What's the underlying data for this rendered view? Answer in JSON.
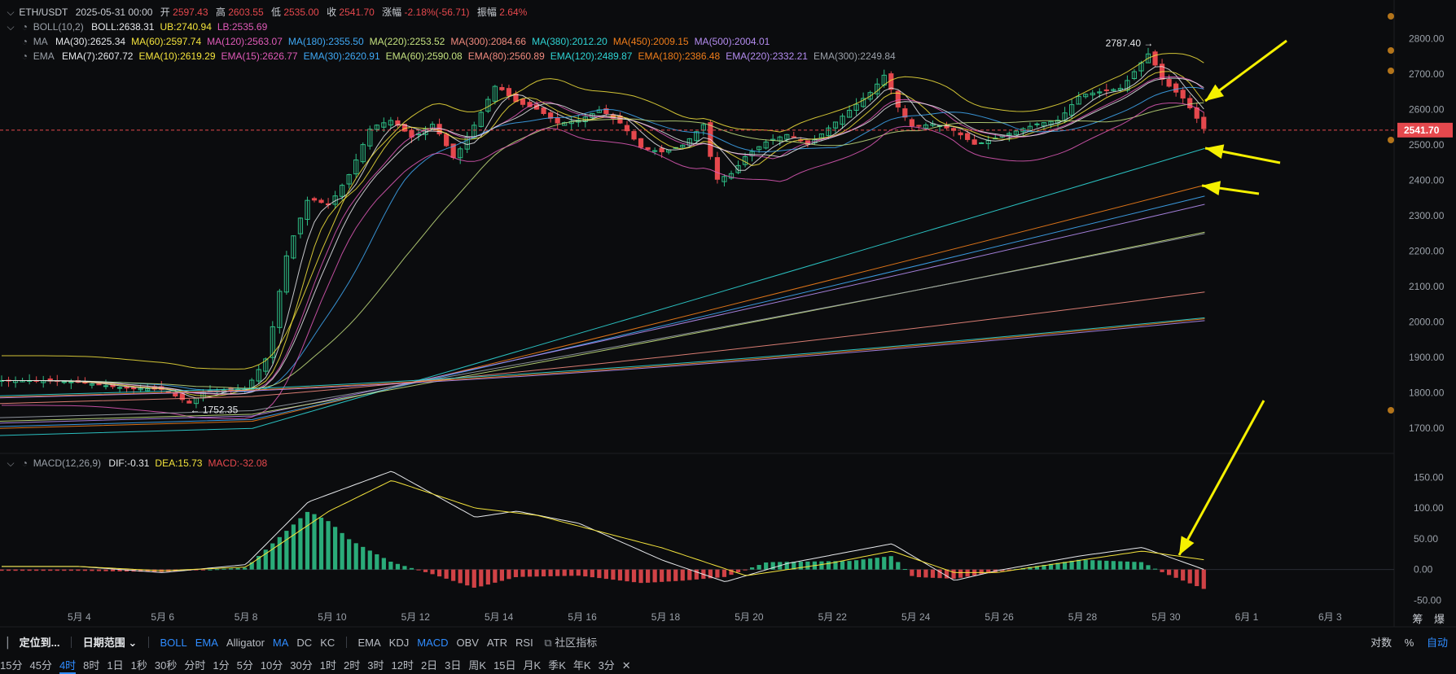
{
  "header": {
    "pair": "ETH/USDT",
    "datetime": "2025-05-31 00:00",
    "open_label": "开",
    "open": "2597.43",
    "high_label": "高",
    "high": "2603.55",
    "low_label": "低",
    "low": "2535.00",
    "close_label": "收",
    "close": "2541.70",
    "change_label": "涨幅",
    "change": "-2.18%(-56.71)",
    "amp_label": "振幅",
    "amp": "2.64%"
  },
  "boll": {
    "name": "BOLL(10,2)",
    "items": [
      {
        "text": "BOLL:2638.31",
        "color": "#e6e8eb"
      },
      {
        "text": "UB:2740.94",
        "color": "#f3e33c"
      },
      {
        "text": "LB:2535.69",
        "color": "#e05ab8"
      }
    ]
  },
  "ma": {
    "name": "MA",
    "items": [
      {
        "text": "MA(30):2625.34",
        "color": "#e6e8eb"
      },
      {
        "text": "MA(60):2597.74",
        "color": "#f3e33c"
      },
      {
        "text": "MA(120):2563.07",
        "color": "#e05ab8"
      },
      {
        "text": "MA(180):2355.50",
        "color": "#3fa9f5"
      },
      {
        "text": "MA(220):2253.52",
        "color": "#c4e17f"
      },
      {
        "text": "MA(300):2084.66",
        "color": "#f08a7e"
      },
      {
        "text": "MA(380):2012.20",
        "color": "#2ed3d3"
      },
      {
        "text": "MA(450):2009.15",
        "color": "#f07d1a"
      },
      {
        "text": "MA(500):2004.01",
        "color": "#b48cf0"
      }
    ]
  },
  "ema": {
    "name": "EMA",
    "items": [
      {
        "text": "EMA(7):2607.72",
        "color": "#e6e8eb"
      },
      {
        "text": "EMA(10):2619.29",
        "color": "#f3e33c"
      },
      {
        "text": "EMA(15):2626.77",
        "color": "#e05ab8"
      },
      {
        "text": "EMA(30):2620.91",
        "color": "#3fa9f5"
      },
      {
        "text": "EMA(60):2590.08",
        "color": "#c4e17f"
      },
      {
        "text": "EMA(80):2560.89",
        "color": "#f08a7e"
      },
      {
        "text": "EMA(120):2489.87",
        "color": "#2ed3d3"
      },
      {
        "text": "EMA(180):2386.48",
        "color": "#f07d1a"
      },
      {
        "text": "EMA(220):2332.21",
        "color": "#b48cf0"
      },
      {
        "text": "EMA(300):2249.84",
        "color": "#9aa0a8"
      }
    ]
  },
  "macd": {
    "name": "MACD(12,26,9)",
    "items": [
      {
        "text": "DIF:-0.31",
        "color": "#e6e8eb"
      },
      {
        "text": "DEA:15.73",
        "color": "#f3e33c"
      },
      {
        "text": "MACD:-32.08",
        "color": "#e5484d"
      }
    ]
  },
  "bottom_bar": {
    "locate": "定位到...",
    "date_range": "日期范围",
    "main_indicators": [
      "BOLL",
      "EMA",
      "Alligator",
      "MA",
      "DC",
      "KC"
    ],
    "main_active": [
      "BOLL",
      "EMA",
      "MA"
    ],
    "sub_indicators": [
      "EMA",
      "KDJ",
      "MACD",
      "OBV",
      "ATR",
      "RSI"
    ],
    "sub_active": [
      "MACD"
    ],
    "community": "社区指标",
    "scale_log": "对数",
    "scale_pct": "%",
    "scale_auto": "自动",
    "right_labels": [
      "筹",
      "爆"
    ]
  },
  "timeframes": [
    "15分",
    "45分",
    "4时",
    "8时",
    "1日",
    "1秒",
    "30秒",
    "分时",
    "1分",
    "5分",
    "10分",
    "30分",
    "1时",
    "2时",
    "3时",
    "12时",
    "2日",
    "3日",
    "周K",
    "15日",
    "月K",
    "季K",
    "年K",
    "3分"
  ],
  "timeframe_active": "4时",
  "chart_data": [
    {
      "type": "candlestick",
      "title": "ETH/USDT 4h",
      "x_tick_labels": [
        "5月 4",
        "5月 6",
        "5月 8",
        "5月 10",
        "5月 12",
        "5月 14",
        "5月 16",
        "5月 18",
        "5月 20",
        "5月 22",
        "5月 24",
        "5月 26",
        "5月 28",
        "5月 30",
        "6月 1",
        "6月 3"
      ],
      "y_ticks": [
        1700,
        1800,
        1900,
        2000,
        2100,
        2200,
        2300,
        2400,
        2500,
        2600,
        2700,
        2800
      ],
      "ylim": [
        1650,
        2840
      ],
      "current_price_label": "2541.70",
      "annotations": [
        {
          "text": "2787.40 →",
          "x": "5月 29 20:00",
          "y": 2787.4
        },
        {
          "text": "← 1752.35",
          "x": "5月 6 16:00",
          "y": 1752.35
        }
      ],
      "ohlc_4h_waypoints": [
        {
          "x": "5月 3 00:00",
          "close": 1835
        },
        {
          "x": "5月 4 00:00",
          "close": 1830
        },
        {
          "x": "5月 5 00:00",
          "close": 1815
        },
        {
          "x": "5月 6 00:00",
          "close": 1810
        },
        {
          "x": "5月 6 16:00",
          "close": 1770
        },
        {
          "x": "5月 7 00:00",
          "close": 1805
        },
        {
          "x": "5月 8 00:00",
          "close": 1810
        },
        {
          "x": "5月 8 12:00",
          "close": 1900
        },
        {
          "x": "5月 9 00:00",
          "close": 2200
        },
        {
          "x": "5月 9 12:00",
          "close": 2350
        },
        {
          "x": "5月 10 00:00",
          "close": 2330
        },
        {
          "x": "5月 10 12:00",
          "close": 2420
        },
        {
          "x": "5月 11 00:00",
          "close": 2550
        },
        {
          "x": "5月 11 12:00",
          "close": 2570
        },
        {
          "x": "5月 12 00:00",
          "close": 2520
        },
        {
          "x": "5月 12 12:00",
          "close": 2560
        },
        {
          "x": "5月 13 00:00",
          "close": 2460
        },
        {
          "x": "5月 13 12:00",
          "close": 2560
        },
        {
          "x": "5月 14 00:00",
          "close": 2670
        },
        {
          "x": "5月 14 12:00",
          "close": 2620
        },
        {
          "x": "5月 15 00:00",
          "close": 2600
        },
        {
          "x": "5月 15 12:00",
          "close": 2560
        },
        {
          "x": "5月 16 00:00",
          "close": 2570
        },
        {
          "x": "5月 16 12:00",
          "close": 2600
        },
        {
          "x": "5月 17 00:00",
          "close": 2560
        },
        {
          "x": "5月 17 12:00",
          "close": 2490
        },
        {
          "x": "5月 18 00:00",
          "close": 2480
        },
        {
          "x": "5月 18 12:00",
          "close": 2500
        },
        {
          "x": "5月 19 00:00",
          "close": 2560
        },
        {
          "x": "5月 19 06:00",
          "close": 2400
        },
        {
          "x": "5月 19 16:00",
          "close": 2420
        },
        {
          "x": "5月 20 00:00",
          "close": 2470
        },
        {
          "x": "5月 20 12:00",
          "close": 2510
        },
        {
          "x": "5月 21 00:00",
          "close": 2530
        },
        {
          "x": "5月 21 12:00",
          "close": 2500
        },
        {
          "x": "5月 22 00:00",
          "close": 2550
        },
        {
          "x": "5月 22 12:00",
          "close": 2600
        },
        {
          "x": "5月 23 00:00",
          "close": 2650
        },
        {
          "x": "5月 23 08:00",
          "close": 2700
        },
        {
          "x": "5月 23 16:00",
          "close": 2600
        },
        {
          "x": "5月 24 00:00",
          "close": 2550
        },
        {
          "x": "5月 24 12:00",
          "close": 2560
        },
        {
          "x": "5月 25 00:00",
          "close": 2540
        },
        {
          "x": "5月 25 12:00",
          "close": 2500
        },
        {
          "x": "5月 26 00:00",
          "close": 2520
        },
        {
          "x": "5月 26 12:00",
          "close": 2540
        },
        {
          "x": "5月 27 00:00",
          "close": 2560
        },
        {
          "x": "5月 27 12:00",
          "close": 2570
        },
        {
          "x": "5月 28 00:00",
          "close": 2640
        },
        {
          "x": "5月 28 12:00",
          "close": 2650
        },
        {
          "x": "5月 29 00:00",
          "close": 2660
        },
        {
          "x": "5月 29 16:00",
          "close": 2760
        },
        {
          "x": "5月 30 00:00",
          "close": 2680
        },
        {
          "x": "5月 30 12:00",
          "close": 2630
        },
        {
          "x": "5月 31 00:00",
          "close": 2542
        }
      ],
      "long_ma_endpoints": [
        {
          "name": "EMA(120)",
          "color": "#2ed3d3",
          "start": 1700,
          "end": 2489.87
        },
        {
          "name": "EMA(180)",
          "color": "#f07d1a",
          "start": 1720,
          "end": 2386.48
        },
        {
          "name": "MA(180)",
          "color": "#3fa9f5",
          "start": 1725,
          "end": 2355.5
        },
        {
          "name": "EMA(220)",
          "color": "#b48cf0",
          "start": 1735,
          "end": 2332.21
        },
        {
          "name": "MA(220)",
          "color": "#c4e17f",
          "start": 1740,
          "end": 2253.52
        },
        {
          "name": "EMA(300)",
          "color": "#9aa0a8",
          "start": 1750,
          "end": 2249.84
        },
        {
          "name": "MA(300)",
          "color": "#f08a7e",
          "start": 1790,
          "end": 2084.66
        },
        {
          "name": "MA(380)",
          "color": "#2ed3d3",
          "start": 1812,
          "end": 2012.2
        },
        {
          "name": "MA(450)",
          "color": "#f07d1a",
          "start": 1808,
          "end": 2009.15
        },
        {
          "name": "MA(500)",
          "color": "#b48cf0",
          "start": 1806,
          "end": 2004.01
        }
      ]
    },
    {
      "type": "bar",
      "title": "MACD(12,26,9)",
      "y_ticks": [
        -50,
        0,
        50,
        100,
        150
      ],
      "ylim": [
        -60,
        165
      ],
      "histogram_waypoints": [
        {
          "x": "5月 4",
          "value": -2
        },
        {
          "x": "5月 6",
          "value": -4
        },
        {
          "x": "5月 8",
          "value": 3
        },
        {
          "x": "5月 9 12:00",
          "value": 95
        },
        {
          "x": "5月 10 00:00",
          "value": 78
        },
        {
          "x": "5月 10 12:00",
          "value": 48
        },
        {
          "x": "5月 11 12:00",
          "value": 12
        },
        {
          "x": "5月 12 12:00",
          "value": -8
        },
        {
          "x": "5月 13 12:00",
          "value": -30
        },
        {
          "x": "5月 14 12:00",
          "value": -12
        },
        {
          "x": "5月 16",
          "value": -10
        },
        {
          "x": "5月 17 12:00",
          "value": -22
        },
        {
          "x": "5月 18 12:00",
          "value": -18
        },
        {
          "x": "5月 19 12:00",
          "value": -12
        },
        {
          "x": "5月 20 12:00",
          "value": 12
        },
        {
          "x": "5月 22 12:00",
          "value": 14
        },
        {
          "x": "5月 23 12:00",
          "value": 22
        },
        {
          "x": "5月 24",
          "value": -12
        },
        {
          "x": "5月 25",
          "value": -15
        },
        {
          "x": "5月 26",
          "value": -4
        },
        {
          "x": "5月 28",
          "value": 16
        },
        {
          "x": "5月 29 12:00",
          "value": 12
        },
        {
          "x": "5月 30",
          "value": -5
        },
        {
          "x": "5月 31",
          "value": -32.08
        }
      ],
      "dif_waypoints": [
        {
          "x": "5月 4",
          "value": 5
        },
        {
          "x": "5月 6",
          "value": -5
        },
        {
          "x": "5月 8",
          "value": 8
        },
        {
          "x": "5月 9 12:00",
          "value": 110
        },
        {
          "x": "5月 11 12:00",
          "value": 160
        },
        {
          "x": "5月 13 12:00",
          "value": 85
        },
        {
          "x": "5月 14 12:00",
          "value": 95
        },
        {
          "x": "5月 16",
          "value": 75
        },
        {
          "x": "5月 18",
          "value": 15
        },
        {
          "x": "5月 19 12:00",
          "value": -20
        },
        {
          "x": "5月 21",
          "value": 10
        },
        {
          "x": "5月 23 12:00",
          "value": 42
        },
        {
          "x": "5月 25",
          "value": -18
        },
        {
          "x": "5月 26",
          "value": -2
        },
        {
          "x": "5月 28",
          "value": 22
        },
        {
          "x": "5月 29 12:00",
          "value": 36
        },
        {
          "x": "5月 31",
          "value": -0.31
        }
      ],
      "dea_waypoints": [
        {
          "x": "5月 4",
          "value": 5
        },
        {
          "x": "5月 6",
          "value": -2
        },
        {
          "x": "5月 8",
          "value": 4
        },
        {
          "x": "5月 10",
          "value": 95
        },
        {
          "x": "5月 11 12:00",
          "value": 145
        },
        {
          "x": "5月 13 12:00",
          "value": 100
        },
        {
          "x": "5月 15",
          "value": 88
        },
        {
          "x": "5月 18",
          "value": 35
        },
        {
          "x": "5月 20",
          "value": -10
        },
        {
          "x": "5月 22",
          "value": 10
        },
        {
          "x": "5月 23 12:00",
          "value": 30
        },
        {
          "x": "5月 25",
          "value": -5
        },
        {
          "x": "5月 26",
          "value": -5
        },
        {
          "x": "5月 28",
          "value": 15
        },
        {
          "x": "5月 29 12:00",
          "value": 30
        },
        {
          "x": "5月 31",
          "value": 15.73
        }
      ]
    }
  ]
}
